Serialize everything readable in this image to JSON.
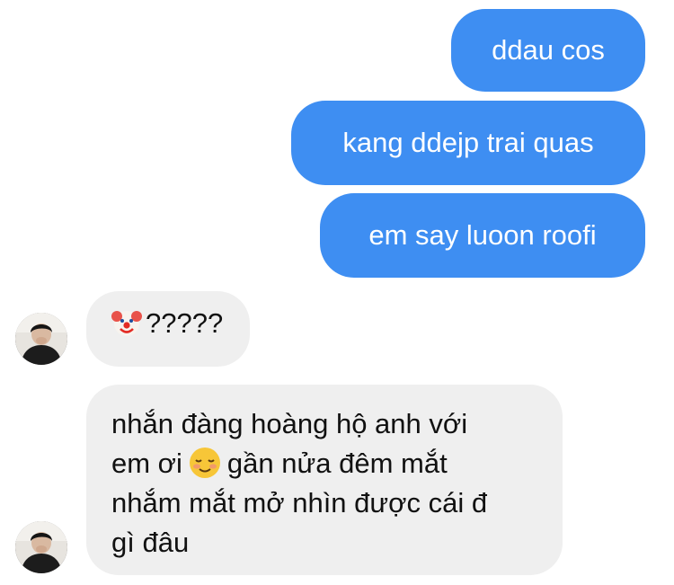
{
  "conversation": {
    "sent_messages": [
      "ddau cos",
      "kang ddejp trai quas",
      "em say luoon roofi"
    ],
    "received_messages": [
      {
        "emoji": "clown-face",
        "text": "?????"
      },
      {
        "line1": "nhắn đàng hoàng hộ anh với",
        "line2_a": "em ơi",
        "emoji": "smiling-face",
        "line2_b": "gần nửa đêm mắt",
        "line3": "nhắm mắt mở nhìn được cái đ",
        "line4": "gì đâu"
      }
    ]
  },
  "colors": {
    "sent_bubble": "#3e8ef2",
    "received_bubble": "#efefef",
    "sent_text": "#ffffff",
    "received_text": "#111111"
  }
}
